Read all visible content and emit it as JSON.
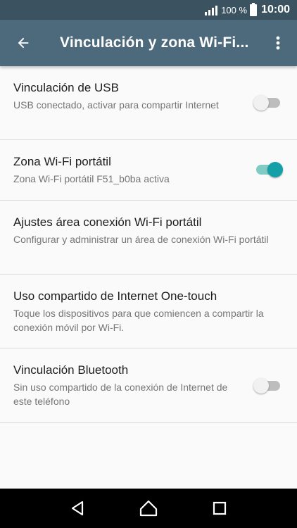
{
  "status_bar": {
    "battery_percent": "100 %",
    "time": "10:00",
    "icons": [
      "signal-icon",
      "battery-icon"
    ]
  },
  "app_bar": {
    "title": "Vinculación y zona Wi-Fi...",
    "icons": [
      "back-arrow-icon",
      "more-vert-icon"
    ]
  },
  "colors": {
    "status_bar": "#3b5261",
    "app_bar": "#4d6a7d",
    "accent": "#15a0a8",
    "accent_track": "#80cbc4"
  },
  "settings": [
    {
      "title": "Vinculación de USB",
      "summary": "USB conectado, activar para compartir Internet",
      "toggle": "off"
    },
    {
      "title": "Zona Wi-Fi portátil",
      "summary": "Zona Wi-Fi portátil F51_b0ba activa",
      "toggle": "on"
    },
    {
      "title": "Ajustes área conexión Wi-Fi portátil",
      "summary": "Configurar y administrar un área de conexión Wi-Fi portátil"
    },
    {
      "title": "Uso compartido de Internet One-touch",
      "summary": "Toque los dispositivos para que comiencen a compartir la conexión móvil por Wi-Fi."
    },
    {
      "title": "Vinculación Bluetooth",
      "summary": "Sin uso compartido de la conexión de Internet de este teléfono",
      "toggle": "off"
    }
  ],
  "nav_bar": {
    "icons": [
      "back-triangle-icon",
      "home-circle-icon",
      "recents-square-icon"
    ]
  }
}
